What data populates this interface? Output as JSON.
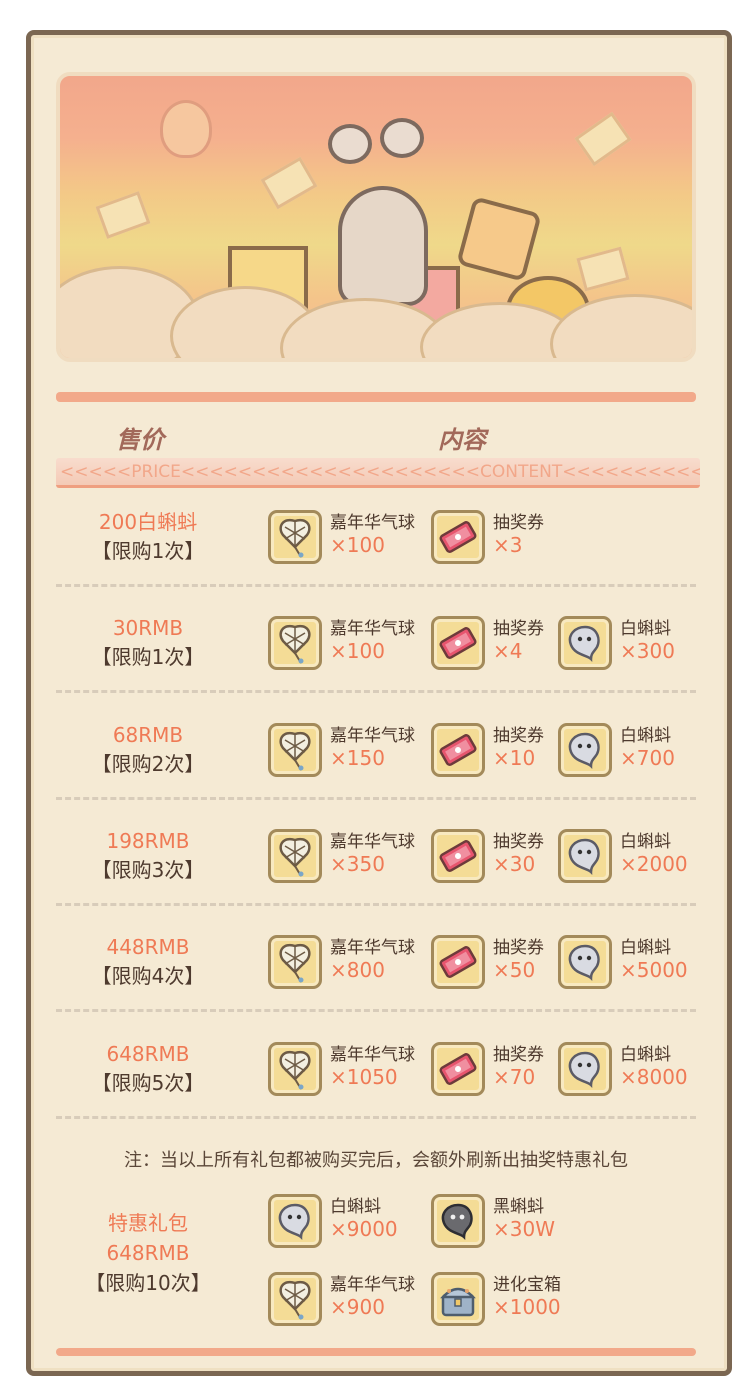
{
  "header": {
    "price_label": "售价",
    "content_label": "内容",
    "strip_text": "<<<<<PRICE<<<<<<<<<<<<<<<<<<<<<CONTENT<<<<<<<<<<<<<<<<<<"
  },
  "rows": [
    {
      "price": "200白蝌蚪",
      "limit": "【限购1次】",
      "items": [
        {
          "name": "嘉年华气球",
          "qty": "×100",
          "icon": "balloon-icon"
        },
        {
          "name": "抽奖券",
          "qty": "×3",
          "icon": "ticket-icon"
        }
      ]
    },
    {
      "price": "30RMB",
      "limit": "【限购1次】",
      "items": [
        {
          "name": "嘉年华气球",
          "qty": "×100",
          "icon": "balloon-icon"
        },
        {
          "name": "抽奖券",
          "qty": "×4",
          "icon": "ticket-icon"
        },
        {
          "name": "白蝌蚪",
          "qty": "×300",
          "icon": "white-tadpole-icon"
        }
      ]
    },
    {
      "price": "68RMB",
      "limit": "【限购2次】",
      "items": [
        {
          "name": "嘉年华气球",
          "qty": "×150",
          "icon": "balloon-icon"
        },
        {
          "name": "抽奖券",
          "qty": "×10",
          "icon": "ticket-icon"
        },
        {
          "name": "白蝌蚪",
          "qty": "×700",
          "icon": "white-tadpole-icon"
        }
      ]
    },
    {
      "price": "198RMB",
      "limit": "【限购3次】",
      "items": [
        {
          "name": "嘉年华气球",
          "qty": "×350",
          "icon": "balloon-icon"
        },
        {
          "name": "抽奖券",
          "qty": "×30",
          "icon": "ticket-icon"
        },
        {
          "name": "白蝌蚪",
          "qty": "×2000",
          "icon": "white-tadpole-icon"
        }
      ]
    },
    {
      "price": "448RMB",
      "limit": "【限购4次】",
      "items": [
        {
          "name": "嘉年华气球",
          "qty": "×800",
          "icon": "balloon-icon"
        },
        {
          "name": "抽奖券",
          "qty": "×50",
          "icon": "ticket-icon"
        },
        {
          "name": "白蝌蚪",
          "qty": "×5000",
          "icon": "white-tadpole-icon"
        }
      ]
    },
    {
      "price": "648RMB",
      "limit": "【限购5次】",
      "items": [
        {
          "name": "嘉年华气球",
          "qty": "×1050",
          "icon": "balloon-icon"
        },
        {
          "name": "抽奖券",
          "qty": "×70",
          "icon": "ticket-icon"
        },
        {
          "name": "白蝌蚪",
          "qty": "×8000",
          "icon": "white-tadpole-icon"
        }
      ]
    }
  ],
  "note": "注：当以上所有礼包都被购买完后，会额外刷新出抽奖特惠礼包",
  "special": {
    "title": "特惠礼包",
    "price": "648RMB",
    "limit": "【限购10次】",
    "items": [
      {
        "name": "白蝌蚪",
        "qty": "×9000",
        "icon": "white-tadpole-icon"
      },
      {
        "name": "黑蝌蚪",
        "qty": "×30W",
        "icon": "black-tadpole-icon"
      },
      {
        "name": "嘉年华气球",
        "qty": "×900",
        "icon": "balloon-icon"
      },
      {
        "name": "进化宝箱",
        "qty": "×1000",
        "icon": "evolution-chest-icon"
      }
    ]
  },
  "colors": {
    "price": "#ef7a55",
    "text": "#4e3a2e",
    "paper": "#f5ead4",
    "accent_band": "#f2a98a"
  }
}
